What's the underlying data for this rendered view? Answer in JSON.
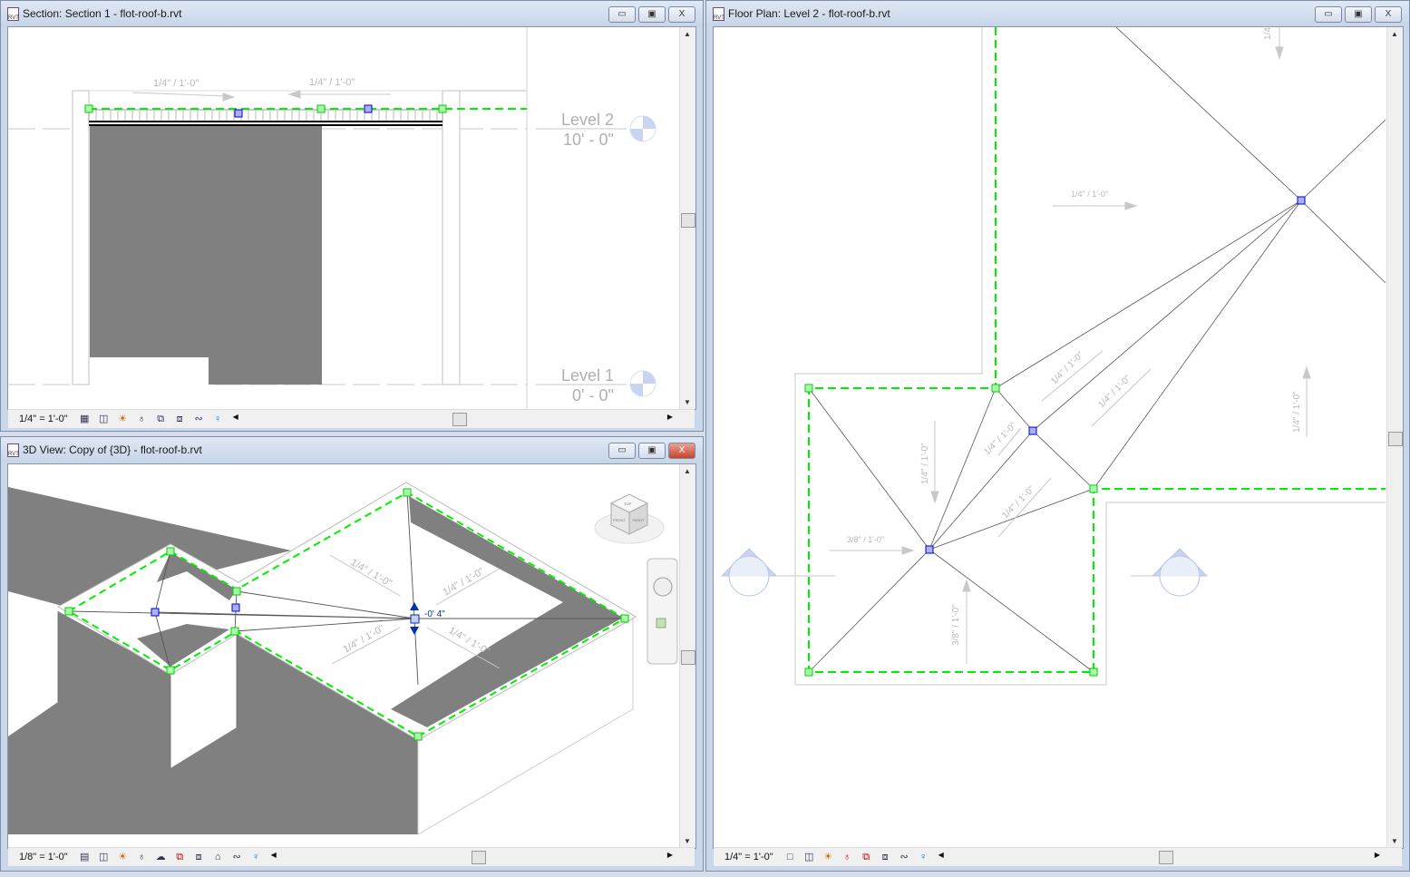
{
  "windows": {
    "section": {
      "title": "Section: Section 1 - flot-roof-b.rvt",
      "scale": "1/4\" = 1'-0\"",
      "slopes": [
        "1/4\" / 1'-0\"",
        "1/4\" / 1'-0\""
      ],
      "levels": [
        {
          "name": "Level 2",
          "elevation": "10' - 0\""
        },
        {
          "name": "Level 1",
          "elevation": "0' - 0\""
        }
      ]
    },
    "view3d": {
      "title": "3D View: Copy of {3D} - flot-roof-b.rvt",
      "scale": "1/8\" = 1'-0\"",
      "slopes": [
        "1/4\" / 1'-0\"",
        "1/4\" / 1'-0\"",
        "1/4\" / 1'-0\"",
        "1/4\" / 1'-0\""
      ],
      "offset_value": "-0'  4\"",
      "viewcube": {
        "top": "TOP",
        "front": "FRONT",
        "right": "RIGHT"
      }
    },
    "plan": {
      "title": "Floor Plan: Level 2 - flot-roof-b.rvt",
      "scale": "1/4\" = 1'-0\"",
      "slopes": [
        "1/4\" / 1'-0\"",
        "1/4\" / 1'-0\"",
        "1/4\" / 1'-0\"",
        "1/4\" / 1'-0\"",
        "1/4\" / 1'-0\"",
        "1/4\" / 1'-0\"",
        "3/8\" / 1'-0\"",
        "3/8\" / 1'-0\"",
        "1/4\" / 1'-0\"",
        "1/4"
      ]
    }
  },
  "window_buttons": {
    "minimize": "▭",
    "restore": "▣",
    "close": "X"
  },
  "colors": {
    "accent_green": "#00ee00",
    "handle_blue": "#2222cc",
    "fill_gray": "#808080"
  }
}
